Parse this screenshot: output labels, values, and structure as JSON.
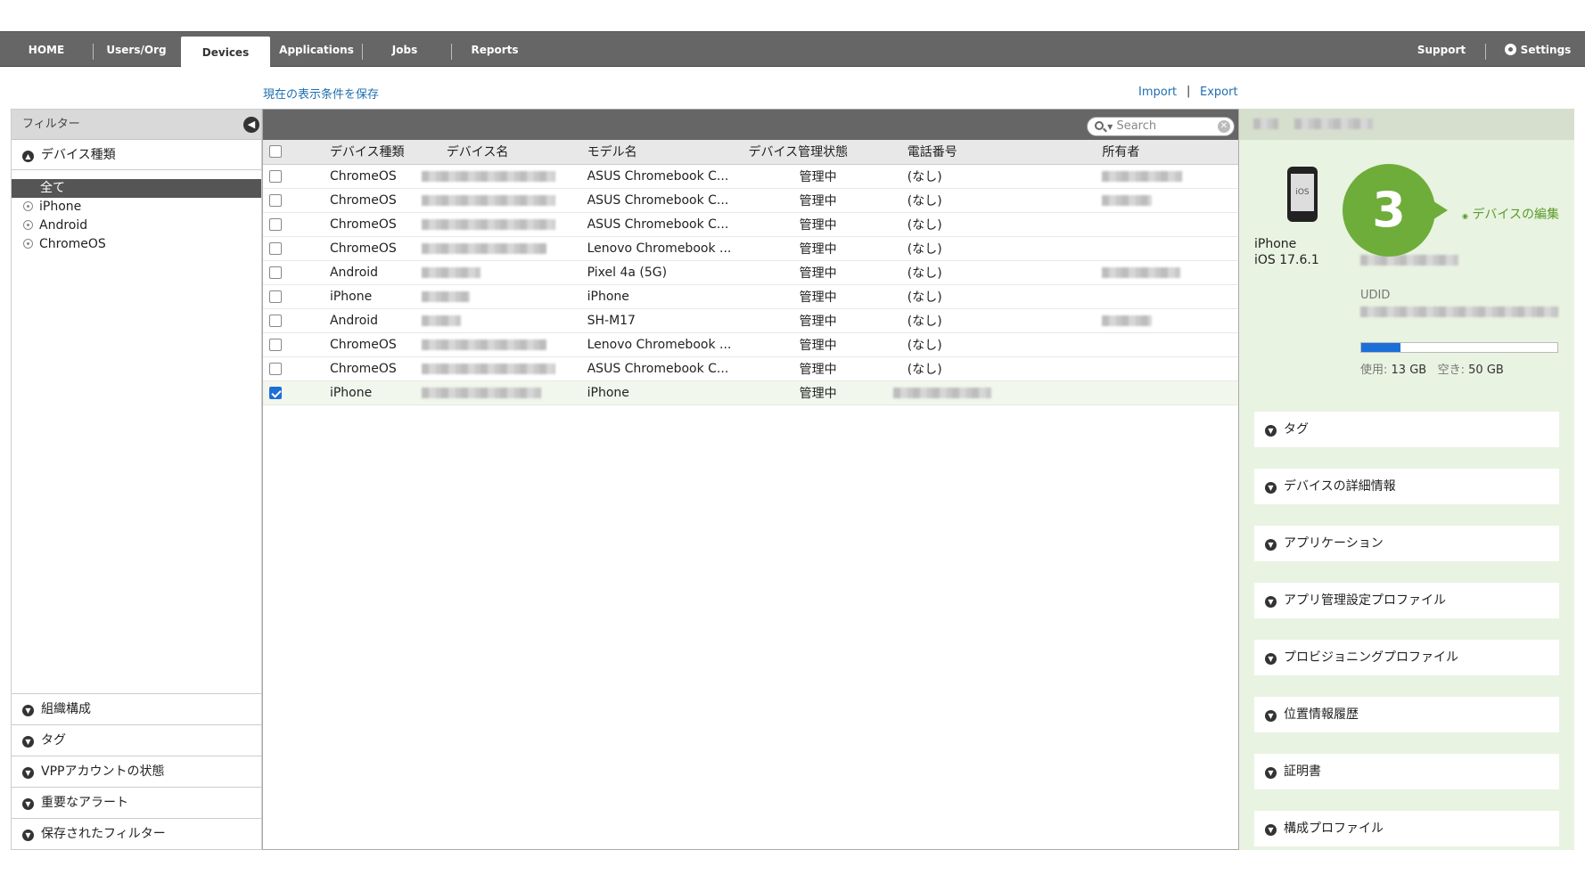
{
  "nav": {
    "items": [
      "HOME",
      "Users/Org",
      "Devices",
      "Applications",
      "Jobs",
      "Reports"
    ],
    "right": [
      "Support",
      "Settings"
    ]
  },
  "links": {
    "save_view": "現在の表示条件を保存",
    "import": "Import",
    "sep": "|",
    "export": "Export"
  },
  "filter": {
    "header": "フィルター",
    "device_type_title": "デバイス種類",
    "items": [
      "全て",
      "iPhone",
      "Android",
      "ChromeOS"
    ],
    "sections": [
      "組織構成",
      "タグ",
      "VPPアカウントの状態",
      "重要なアラート",
      "保存されたフィルター"
    ]
  },
  "search": {
    "placeholder": "Search"
  },
  "table": {
    "columns": [
      "デバイス種類",
      "デバイス名",
      "モデル名",
      "デバイス管理状態",
      "電話番号",
      "所有者"
    ],
    "rows": [
      {
        "type": "ChromeOS",
        "model": "ASUS Chromebook C...",
        "status": "管理中",
        "phone": "(なし)",
        "checked": false
      },
      {
        "type": "ChromeOS",
        "model": "ASUS Chromebook C...",
        "status": "管理中",
        "phone": "(なし)",
        "checked": false
      },
      {
        "type": "ChromeOS",
        "model": "ASUS Chromebook C...",
        "status": "管理中",
        "phone": "(なし)",
        "checked": false
      },
      {
        "type": "ChromeOS",
        "model": "Lenovo Chromebook ...",
        "status": "管理中",
        "phone": "(なし)",
        "checked": false
      },
      {
        "type": "Android",
        "model": "Pixel 4a (5G)",
        "status": "管理中",
        "phone": "(なし)",
        "checked": false
      },
      {
        "type": "iPhone",
        "model": "iPhone",
        "status": "管理中",
        "phone": "(なし)",
        "checked": false
      },
      {
        "type": "Android",
        "model": "SH-M17",
        "status": "管理中",
        "phone": "(なし)",
        "checked": false
      },
      {
        "type": "ChromeOS",
        "model": "Lenovo Chromebook ...",
        "status": "管理中",
        "phone": "(なし)",
        "checked": false
      },
      {
        "type": "ChromeOS",
        "model": "ASUS Chromebook C...",
        "status": "管理中",
        "phone": "(なし)",
        "checked": false
      },
      {
        "type": "iPhone",
        "model": "iPhone",
        "status": "管理中",
        "phone": "",
        "checked": true
      }
    ]
  },
  "detail": {
    "device_model": "iPhone",
    "os": "iOS 17.6.1",
    "udid_label": "UDID",
    "storage": {
      "used_label": "使用:",
      "used": "13 GB",
      "free_label": "空き:",
      "free": "50 GB",
      "used_fraction": 0.2
    },
    "badge": "3",
    "edit_link": "デバイスの編集",
    "sections": [
      "タグ",
      "デバイスの詳細情報",
      "アプリケーション",
      "アプリ管理設定プロファイル",
      "プロビジョニングプロファイル",
      "位置情報履歴",
      "証明書",
      "構成プロファイル"
    ]
  },
  "colors": {
    "accent": "#1d6fd8",
    "badge": "#6fad3a",
    "nav": "#666666",
    "link": "#1e6fb0"
  }
}
